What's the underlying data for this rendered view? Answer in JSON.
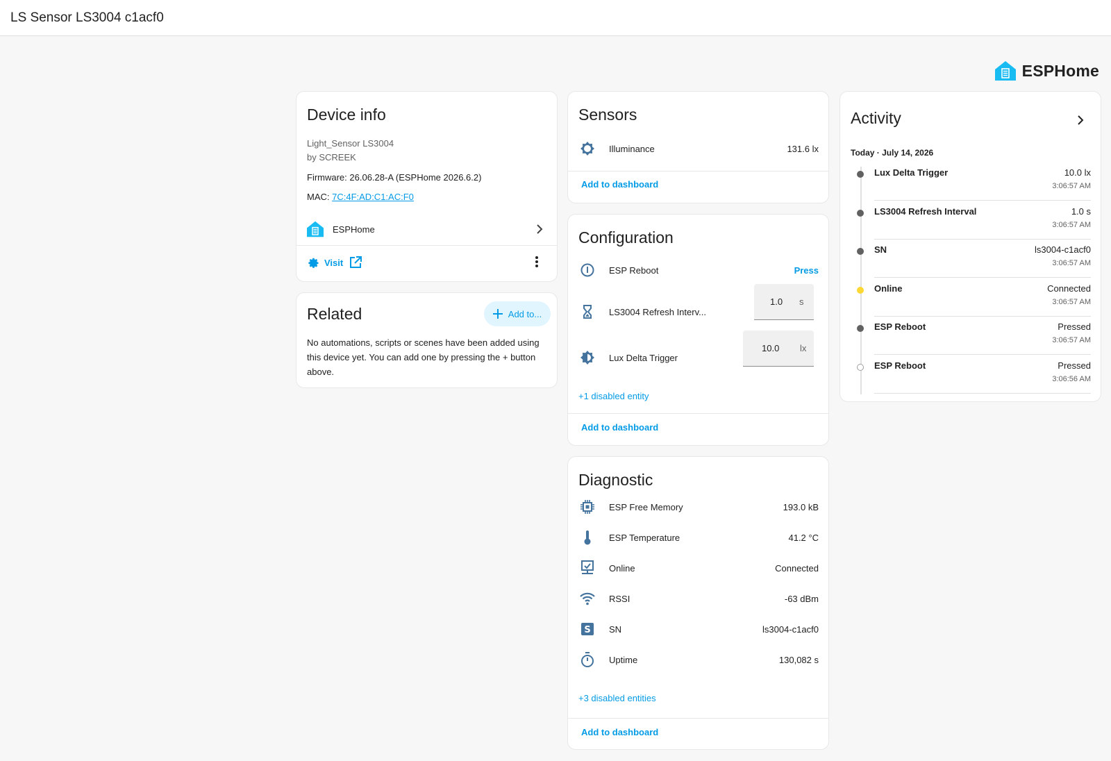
{
  "header": {
    "title": "LS Sensor LS3004 c1acf0"
  },
  "brand": {
    "name": "ESPHome"
  },
  "device_info": {
    "title": "Device info",
    "model": "Light_Sensor LS3004",
    "manufacturer": "by SCREEK",
    "firmware": "Firmware: 26.06.28-A (ESPHome 2026.6.2)",
    "mac_label": "MAC: ",
    "mac": "7C:4F:AD:C1:AC:F0",
    "integration": "ESPHome",
    "visit": "Visit"
  },
  "related": {
    "title": "Related",
    "add_button": "Add to...",
    "text": "No automations, scripts or scenes have been added using this device yet. You can add one by pressing the + button above."
  },
  "sensors": {
    "title": "Sensors",
    "rows": [
      {
        "name": "Illuminance",
        "value": "131.6 lx",
        "icon": "brightness-icon"
      }
    ],
    "add_to_dashboard": "Add to dashboard"
  },
  "configuration": {
    "title": "Configuration",
    "rows": [
      {
        "name": "ESP Reboot",
        "action": "Press",
        "icon": "info-icon"
      },
      {
        "name": "LS3004 Refresh Interv...",
        "value": "1.0",
        "unit": "s",
        "icon": "hourglass-icon"
      },
      {
        "name": "Lux Delta Trigger",
        "value": "10.0",
        "unit": "lx",
        "icon": "brightness-icon"
      }
    ],
    "disabled": "+1 disabled entity",
    "add_to_dashboard": "Add to dashboard"
  },
  "diagnostic": {
    "title": "Diagnostic",
    "rows": [
      {
        "name": "ESP Free Memory",
        "value": "193.0 kB",
        "icon": "chip-icon"
      },
      {
        "name": "ESP Temperature",
        "value": "41.2 °C",
        "icon": "thermometer-icon"
      },
      {
        "name": "Online",
        "value": "Connected",
        "icon": "monitor-check-icon"
      },
      {
        "name": "RSSI",
        "value": "-63 dBm",
        "icon": "wifi-icon"
      },
      {
        "name": "SN",
        "value": "ls3004-c1acf0",
        "icon": "s-badge-icon"
      },
      {
        "name": "Uptime",
        "value": "130,082 s",
        "icon": "timer-icon"
      }
    ],
    "disabled": "+3 disabled entities",
    "add_to_dashboard": "Add to dashboard"
  },
  "activity": {
    "title": "Activity",
    "date": "Today · July 14, 2026",
    "items": [
      {
        "name": "Lux Delta Trigger",
        "value": "10.0 lx",
        "time": "3:06:57 AM",
        "dot": "#616161"
      },
      {
        "name": "LS3004 Refresh Interval",
        "value": "1.0 s",
        "time": "3:06:57 AM",
        "dot": "#616161"
      },
      {
        "name": "SN",
        "value": "ls3004-c1acf0",
        "time": "3:06:57 AM",
        "dot": "#616161"
      },
      {
        "name": "Online",
        "value": "Connected",
        "time": "3:06:57 AM",
        "dot": "#fdd835"
      },
      {
        "name": "ESP Reboot",
        "value": "Pressed",
        "time": "3:06:57 AM",
        "dot": "#616161"
      },
      {
        "name": "ESP Reboot",
        "value": "Pressed",
        "time": "3:06:56 AM",
        "dot": "hollow"
      }
    ]
  },
  "colors": {
    "accent": "#039be5",
    "icon": "#44739e",
    "esphome": "#18bcf2"
  }
}
